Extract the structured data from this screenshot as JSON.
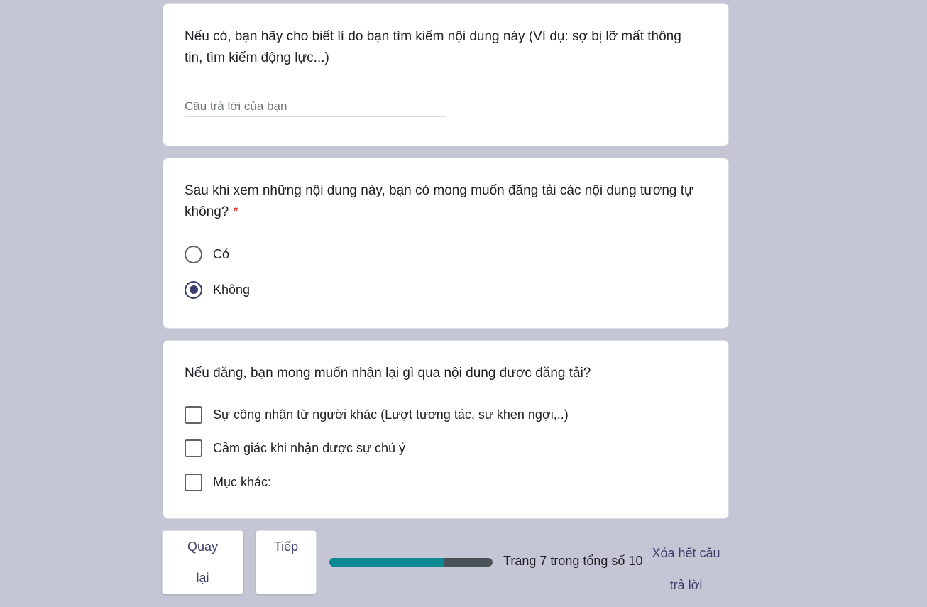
{
  "question_reason": {
    "title": "Nếu có, bạn hãy cho biết lí do bạn tìm kiếm nội dung này (Ví dụ: sợ bị lỡ mất thông tin, tìm kiếm động lực...)",
    "input_value": "",
    "input_placeholder": "Câu trả lời của bạn"
  },
  "question_post": {
    "title": "Sau khi xem những nội dung này, bạn có mong muốn đăng tải các nội dung tương tự không?",
    "required_mark": "*",
    "options": [
      {
        "label": "Có",
        "selected": false
      },
      {
        "label": "Không",
        "selected": true
      }
    ]
  },
  "question_expect": {
    "title": "Nếu đăng, bạn mong muốn nhận lại gì qua nội dung được đăng tải?",
    "options": [
      {
        "label": "Sự công nhận từ người khác (Lượt tương tác, sự khen ngợi,..)",
        "checked": false
      },
      {
        "label": "Cảm giác khi nhận được sự chú ý",
        "checked": false
      },
      {
        "label": "Mục khác:",
        "checked": false
      }
    ],
    "other_value": ""
  },
  "footer": {
    "back_label_line1": "Quay",
    "back_label_line2": "lại",
    "next_label": "Tiếp",
    "progress_fraction": 0.7,
    "progress_text": "Trang 7 trong tổng số 10",
    "clear_label_line1": "Xóa hết câu",
    "clear_label_line2": "trả lời"
  },
  "colors": {
    "background": "#c4c6d5",
    "accent": "#3c3f6b",
    "progress_fill": "#0b8a93",
    "progress_track": "#4b5258",
    "required": "#d93025"
  }
}
